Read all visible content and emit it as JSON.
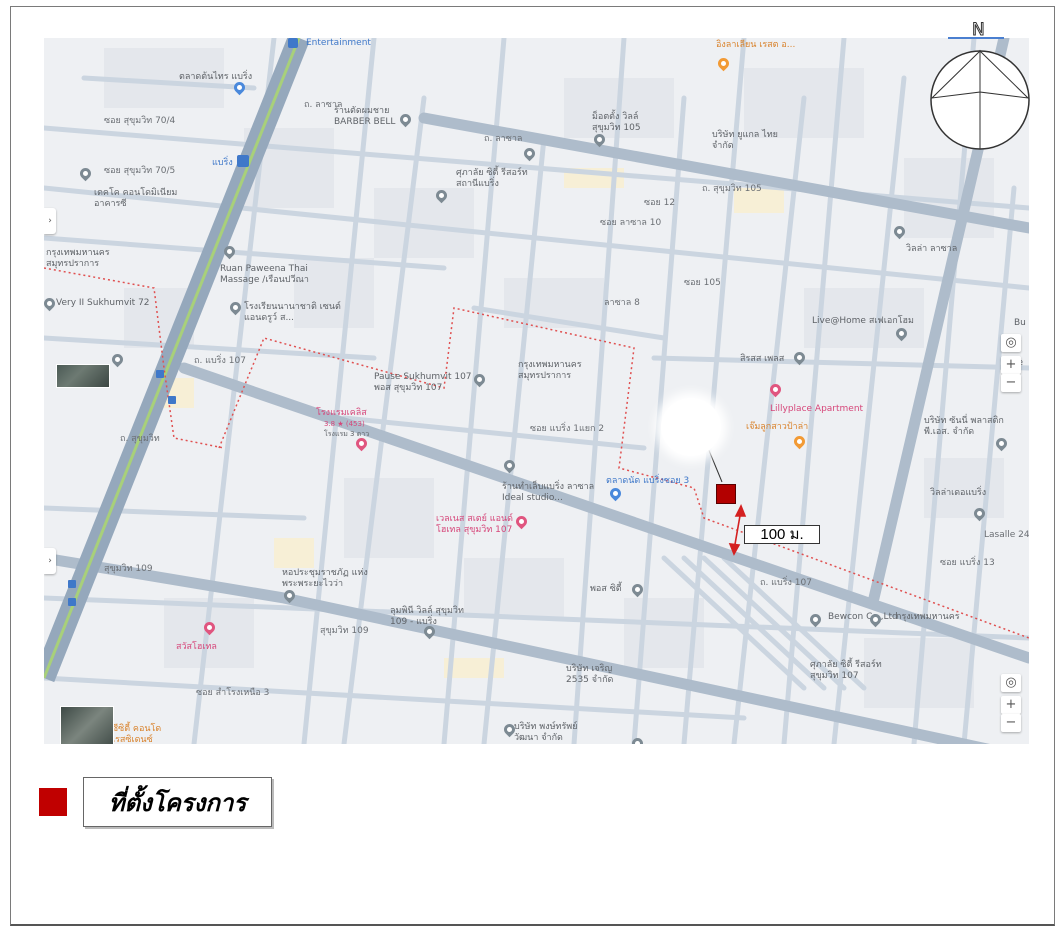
{
  "map": {
    "labels": {
      "entertainment": "Entertainment",
      "talad_ton_sai": "ตลาดต้นไทร แบริ่ง",
      "soi_70_4": "ซอย สุขุมวิท 70/4",
      "soi_70_5": "ซอย สุขุมวิท 70/5",
      "bearing_station": "แบริ่ง",
      "decollo": "เดคโค คอนโดมิเนียม อาคารซี",
      "barber_bell": "ร้านตัดผมชาย BARBER BELL",
      "lasalle_1": "ถ. ลาซาล",
      "lasalle_2": "ถ. ลาซาล",
      "sukhumvit_105_road": "ถ. สุขุมวิท 105",
      "seven_eleven": "อิงลาเลียน เรสต อ...",
      "mon_tong": "ม็อตตั้ง วิลล์ สุขุมวิท 105",
      "company_top": "บริษัท ยูแกล ไทย จำกัด",
      "kusalo": "ศุภาลัย ซิตี้ รีสอร์ท สถานีแบริ่ง",
      "soi_lasalle_10": "ซอย ลาซาล 10",
      "soi_12": "ซอย 12",
      "villa_lasalle": "วิลล่า ลาซาล",
      "bangkok_district_left": "กรุงเทพมหานคร สมุทรปราการ",
      "ruan_paweena": "Ruan Paweena Thai Massage /เรือนปวีณา",
      "very_ii": "Very II Sukhumvit 72",
      "school": "โรงเรียนนานาชาติ เซนต์แอนดรูว์ ส...",
      "lasalle_8": "ลาซาล 8",
      "soi_105": "ซอย 105",
      "live_home": "Live@Home สเฟเอกโฮม",
      "sirasa": "สิรสส เพลส",
      "lillyplace": "Lillyplace Apartment",
      "jaeng": "เจ๊มลูกสาวป้าล่า",
      "bearing_107_road": "ถ. แบริ่ง 107",
      "pause": "Pause Sukhumvit 107 พอส สุขุมวิท 107",
      "bangkok_district_center": "กรุงเทพมหานคร สมุทรปราการ",
      "hotel_left": "โรงแรมเคลิส",
      "hotel_rating": "3.8 ★ (453)",
      "hotel_sub": "โรงแรม 3 ดาว",
      "soi_bearing_1_2": "ซอย แบริ่ง 1แยก 2",
      "talad_bearing": "ตลาดนัด แบริ่งซอย 3",
      "ideal_studio": "ร้านทำเล็บแบริ่ง ลาซาล Ideal studio...",
      "wellness": "เวลเนส สเตย์ แอนด์ โฮเทล สุขุมวิท 107",
      "bearing_right": "บริษัท ซันนี่ พลาสติก พี.เอส. จำกัด",
      "villa_bearing": "วิลล่าเดอแบริ่ง",
      "lasalle_right": "Lasalle 24",
      "sukhumvit_109": "สุขุมวิท 109",
      "sukhumvit_109_b": "สุขุมวิท 109",
      "library": "หอประชุมราชภัฏ แห่งพระพระยะไวว่า",
      "lumpini_villa": "ลุมพินี วิลล์ สุขุมวิท 109 - แบริ่ง",
      "pos_city": "พอส ซิตี้",
      "bewcon": "Bewcon Co.,Ltd",
      "bangkok_district_right": "กรุงเทพมหานคร",
      "bearing_107_b": "ถ. แบริ่ง 107",
      "jaroen": "บริษัท เจริญ 2535 จำกัด",
      "supalai_107": "ศุภาลัย ซิตี้ รีสอร์ท สุขุมวิท 107",
      "sawat_hotel": "สวัสโฮเทล",
      "company_bottom": "บริษัท พงษ์ทรัพย์ วัฒนา จำกัด",
      "sukhumvit_road": "ถ. สุขุมวิท",
      "ccity": "ซีซิตี้ คอนโด เรสซิเดนซ์",
      "soi_samrong_3": "ซอย สำโรงเหนือ 3",
      "soi_bearing_13": "ซอย แบริ่ง 13",
      "bu": "Bu",
      "ve": "Ve"
    },
    "distance_label": "100 ม.",
    "zoom_in": "+",
    "zoom_out": "−",
    "compass_letter": "N"
  },
  "legend": {
    "site_label": "ที่ตั้งโครงการ"
  },
  "colors": {
    "site_marker": "#b30000",
    "legend_swatch": "#c00000",
    "boundary": "#e05050",
    "road_main": "#aebdcd",
    "road_minor": "#c9d3de",
    "bts_line": "#9fc96a"
  }
}
